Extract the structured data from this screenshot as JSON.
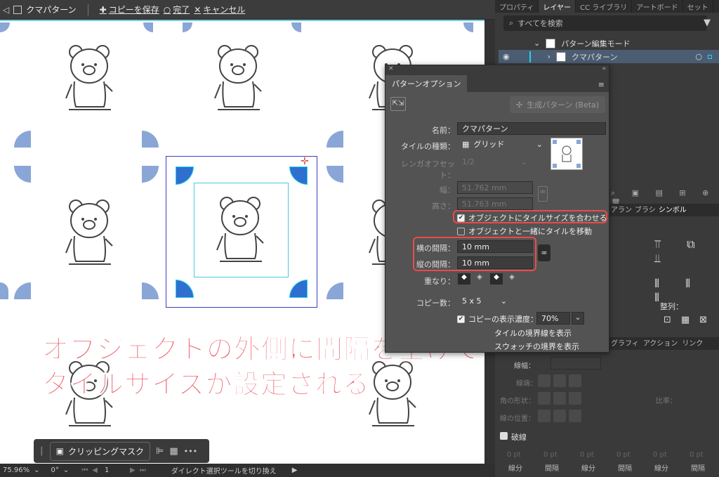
{
  "topbar": {
    "title": "クマパターン",
    "save_copy": "コピーを保存",
    "done": "完了",
    "cancel": "キャンセル"
  },
  "right_tabs": [
    "プロパティ",
    "レイヤー",
    "CC ライブラリ",
    "アートボード",
    "セット"
  ],
  "layers": {
    "search_placeholder": "すべてを検索",
    "items": [
      {
        "name": "パターン編集モード"
      },
      {
        "name": "クマパターン"
      }
    ]
  },
  "pattern_options": {
    "tab": "パターンオプション",
    "generate_label": "生成パターン (Beta)",
    "name_label": "名前：",
    "name_value": "クマパターン",
    "tile_type_label": "タイルの種類：",
    "tile_type_value": "グリッド",
    "brick_offset_label": "レンガオフセット：",
    "brick_offset_value": "1/2",
    "width_label": "幅：",
    "width_value": "51.762 mm",
    "height_label": "高さ：",
    "height_value": "51.763 mm",
    "fit_tile_label": "オブジェクトにタイルサイズを合わせる",
    "move_tile_label": "オブジェクトと一緒にタイルを移動",
    "h_spacing_label": "横の間隔：",
    "h_spacing_value": "10 mm",
    "v_spacing_label": "縦の間隔：",
    "v_spacing_value": "10 mm",
    "overlap_label": "重なり：",
    "copies_label": "コピー数：",
    "copies_value": "5 x 5",
    "dim_copies_label": "コピーの表示濃度：",
    "dim_copies_value": "70%",
    "show_tile_edge_label": "タイルの境界線を表示",
    "show_swatch_bounds_label": "スウォッチの境界を表示"
  },
  "caption": {
    "line1": "オブジェクトの外側に間隔を空けて",
    "line2": "タイルサイズが設定される"
  },
  "clip_toolbar": {
    "clipping_mask": "クリッピングマスク"
  },
  "statusbar": {
    "zoom": "75.96%",
    "rotation": "0°",
    "page": "1",
    "tool": "ダイレクト選択ツールを切り換え"
  },
  "side_panel": {
    "tabs_mid": [
      "アラン",
      "ブラシ",
      "シンボル"
    ],
    "align_label": "整列：",
    "tabs_low": [
      "グラフィ",
      "アクション",
      "リンク"
    ],
    "stroke_width": "線幅：",
    "cap": "線端：",
    "corner": "角の形状：",
    "stroke_pos": "線の位置：",
    "ratio": "比率：",
    "dashed": "破線",
    "dash": "線分",
    "gap": "間隔",
    "pt": "0 pt"
  },
  "colors": {
    "accent_red": "#ea4b4b",
    "tile_blue": "#8aa6d6",
    "selection_cyan": "#2ad1ee"
  }
}
